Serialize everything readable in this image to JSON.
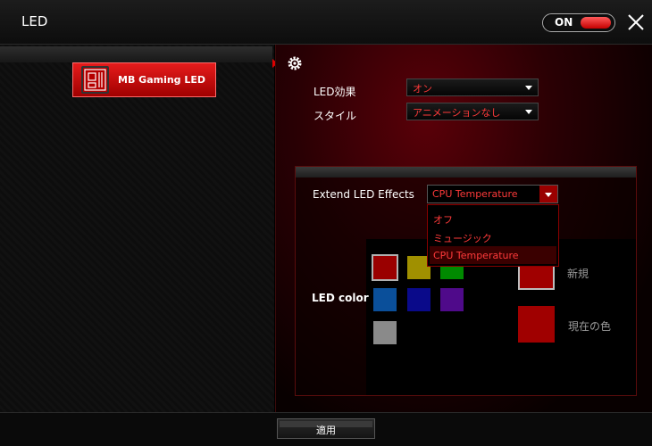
{
  "window": {
    "title": "LED"
  },
  "power_toggle": {
    "label": "ON",
    "state": "on"
  },
  "icons": {
    "close": "close-icon",
    "settings": "gear-icon",
    "motherboard": "motherboard-icon"
  },
  "device_list": {
    "items": [
      {
        "label": "MB Gaming LED",
        "selected": true
      }
    ]
  },
  "settings": {
    "led_effect": {
      "label": "LED効果",
      "value": "オン"
    },
    "style": {
      "label": "スタイル",
      "value": "アニメーションなし"
    }
  },
  "extend": {
    "label": "Extend LED Effects",
    "value": "CPU Temperature",
    "options": [
      "オフ",
      "ミュージック",
      "CPU Temperature"
    ],
    "selected_index": 2
  },
  "led_color": {
    "label": "LED color",
    "swatches": [
      "#9a0000",
      "#a09000",
      "#008a00",
      "#0a4f9a",
      "#0a0a8a",
      "#4f0a8a",
      "#8a8a8a"
    ],
    "selected_swatch": 0,
    "new_label": "新規",
    "current_label": "現在の色",
    "new_color": "#a00000",
    "current_color": "#a00000"
  },
  "footer": {
    "apply_label": "適用"
  },
  "colors": {
    "accent": "#d00000",
    "text_accent": "#ff3a3a"
  }
}
